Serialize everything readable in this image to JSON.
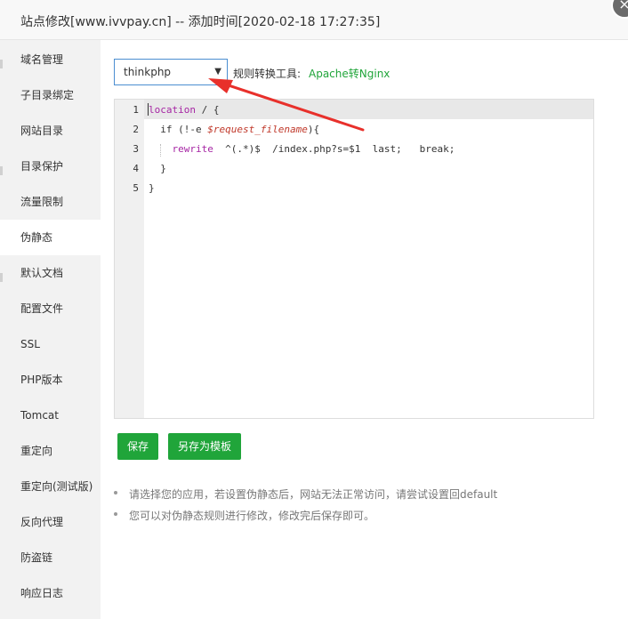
{
  "dialog": {
    "title": "站点修改[www.ivvpay.cn] -- 添加时间[2020-02-18 17:27:35]",
    "close_label": "×"
  },
  "sidebar": {
    "items": [
      {
        "label": "域名管理"
      },
      {
        "label": "子目录绑定"
      },
      {
        "label": "网站目录"
      },
      {
        "label": "目录保护"
      },
      {
        "label": "流量限制"
      },
      {
        "label": "伪静态",
        "active": true
      },
      {
        "label": "默认文档"
      },
      {
        "label": "配置文件"
      },
      {
        "label": "SSL"
      },
      {
        "label": "PHP版本"
      },
      {
        "label": "Tomcat"
      },
      {
        "label": "重定向"
      },
      {
        "label": "重定向(测试版)"
      },
      {
        "label": "反向代理"
      },
      {
        "label": "防盗链"
      },
      {
        "label": "响应日志"
      }
    ]
  },
  "rewrite": {
    "template_select": {
      "value": "thinkphp"
    },
    "rule_tool_label": "规则转换工具:",
    "rule_tool_link": "Apache转Nginx"
  },
  "editor": {
    "line_numbers": [
      "1",
      "2",
      "3",
      "4",
      "5"
    ],
    "lines": [
      "location / {",
      "  if (!-e $request_filename){",
      "    rewrite  ^(.*)$  /index.php?s=$1  last;   break;",
      "  }",
      "}"
    ]
  },
  "buttons": {
    "save": "保存",
    "save_as_template": "另存为模板"
  },
  "tips": [
    "请选择您的应用，若设置伪静态后，网站无法正常访问，请尝试设置回default",
    "您可以对伪静态规则进行修改，修改完后保存即可。"
  ],
  "colors": {
    "accent_green": "#20a53a",
    "arrow_red": "#e8302b",
    "select_border": "#4b8ed1"
  },
  "icons": {
    "close": "close-icon",
    "caret": "caret-down-icon"
  }
}
